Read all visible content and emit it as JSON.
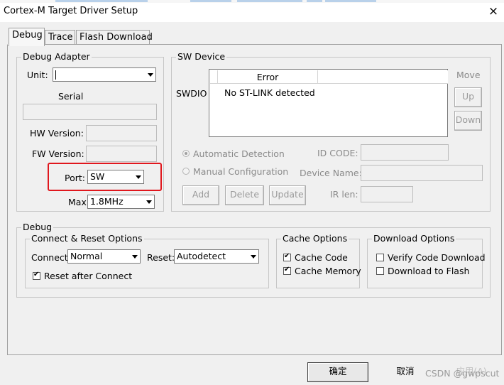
{
  "window": {
    "title": "Cortex-M Target Driver Setup",
    "close_glyph": "×"
  },
  "tabs": [
    {
      "label": "Debug",
      "active": true
    },
    {
      "label": "Trace",
      "active": false
    },
    {
      "label": "Flash Download",
      "active": false
    }
  ],
  "debug_adapter": {
    "legend": "Debug Adapter",
    "unit_label": "Unit:",
    "unit_value": "",
    "serial_label": "Serial",
    "serial_value": "",
    "hw_version_label": "HW Version:",
    "hw_version_value": "",
    "fw_version_label": "FW Version:",
    "fw_version_value": "",
    "port_label": "Port:",
    "port_value": "SW",
    "max_label": "Max",
    "max_value": "1.8MHz"
  },
  "sw_device": {
    "legend": "SW Device",
    "swdio_label": "SWDIO",
    "columns": [
      "Error",
      ""
    ],
    "rows": [
      {
        "error": "No ST-LINK detected"
      }
    ],
    "move_label": "Move",
    "up_button": "Up",
    "down_button": "Down",
    "automatic_detection_label": "Automatic Detection",
    "manual_configuration_label": "Manual Configuration",
    "id_code_label": "ID CODE:",
    "device_name_label": "Device Name:",
    "ir_len_label": "IR len:",
    "add_button": "Add",
    "delete_button": "Delete",
    "update_button": "Update"
  },
  "debug": {
    "legend": "Debug",
    "connect_reset": {
      "legend": "Connect & Reset Options",
      "connect_label": "Connect:",
      "connect_value": "Normal",
      "reset_label": "Reset:",
      "reset_value": "Autodetect",
      "reset_after_connect_label": "Reset after Connect",
      "reset_after_connect_checked": true
    },
    "cache_options": {
      "legend": "Cache Options",
      "cache_code_label": "Cache Code",
      "cache_code_checked": true,
      "cache_memory_label": "Cache Memory",
      "cache_memory_checked": true
    },
    "download_options": {
      "legend": "Download Options",
      "verify_code_download_label": "Verify Code Download",
      "verify_checked": false,
      "download_to_flash_label": "Download to Flash",
      "download_to_flash_checked": false
    }
  },
  "footer": {
    "ok_button": "确定",
    "cancel_button": "取消",
    "apply_button": "应用(A)"
  },
  "watermark": "CSDN @gwpscut",
  "colors": {
    "highlight_box": "#e0171d",
    "dialog_bg": "#f0f0f0"
  }
}
